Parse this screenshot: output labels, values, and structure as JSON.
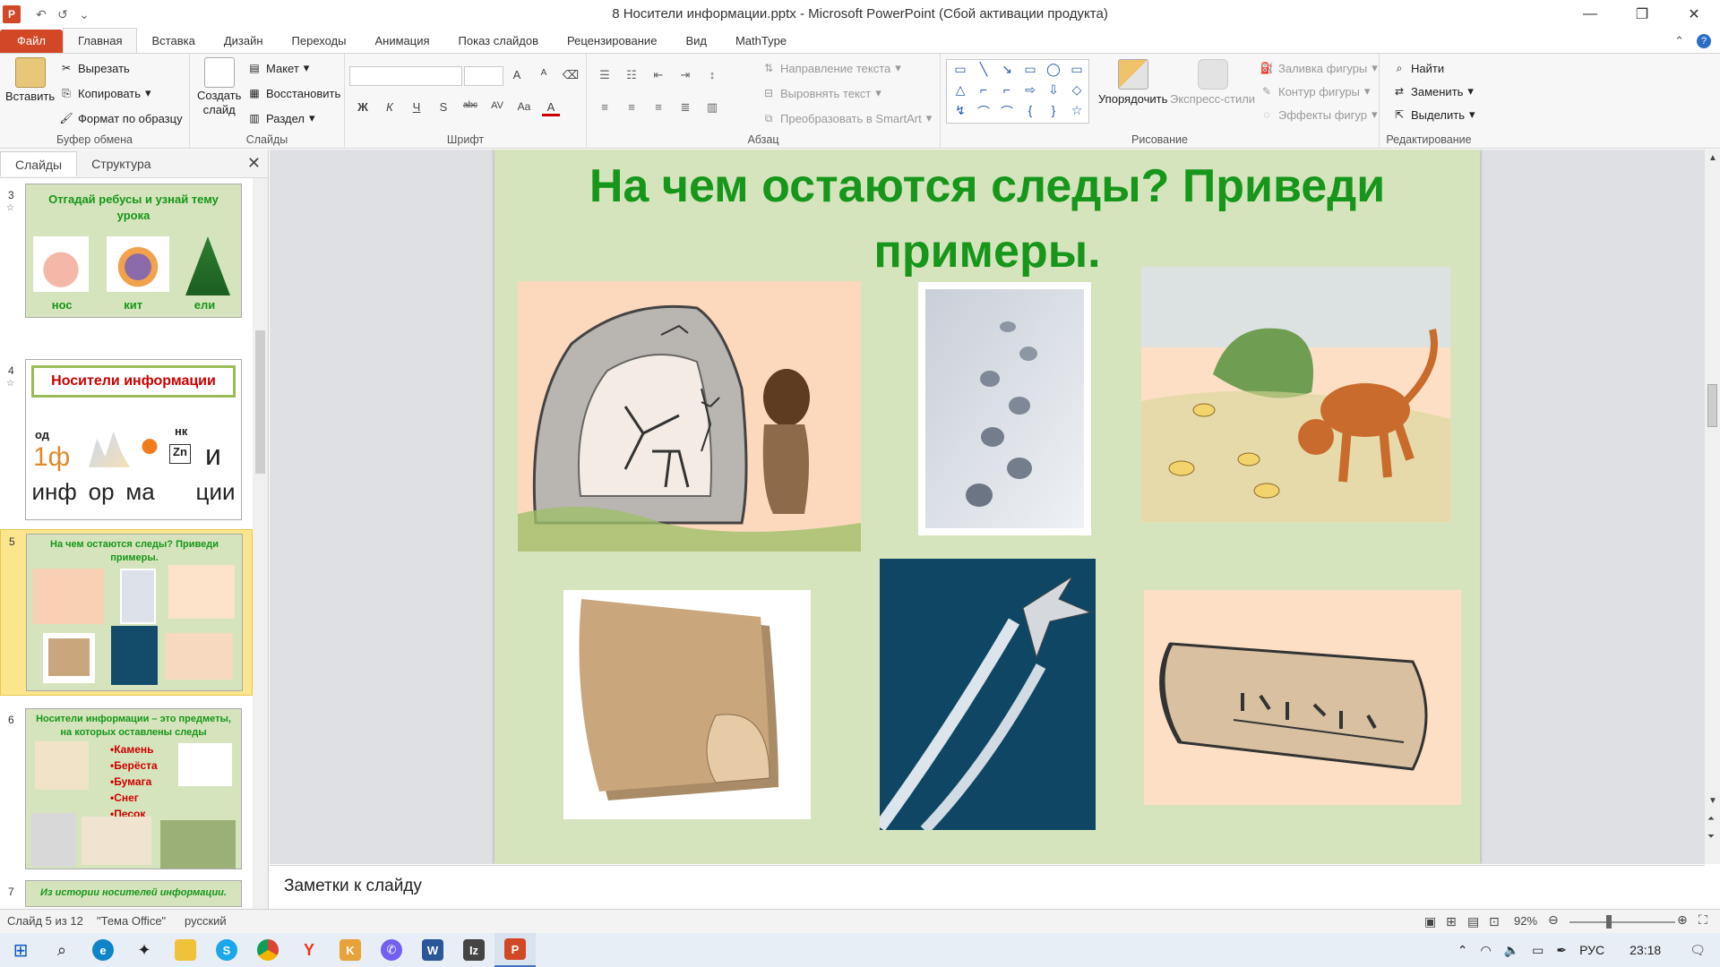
{
  "window": {
    "title": "8 Носители информации.pptx  -  Microsoft PowerPoint (Сбой активации продукта)",
    "app_logo": "P",
    "quick_access": [
      "↶",
      "↺",
      "⌄"
    ],
    "controls": [
      "—",
      "❐",
      "✕"
    ]
  },
  "ribbon": {
    "file_tab": "Файл",
    "tabs": [
      "Главная",
      "Вставка",
      "Дизайн",
      "Переходы",
      "Анимация",
      "Показ слайдов",
      "Рецензирование",
      "Вид",
      "MathType"
    ],
    "active_tab": "Главная",
    "clipboard": {
      "paste": "Вставить",
      "cut": "Вырезать",
      "copy": "Копировать",
      "format_painter": "Формат по образцу",
      "label": "Буфер обмена"
    },
    "slides": {
      "new_slide_line1": "Создать",
      "new_slide_line2": "слайд",
      "layout": "Макет",
      "reset": "Восстановить",
      "section": "Раздел",
      "label": "Слайды"
    },
    "font": {
      "bold": "Ж",
      "italic": "К",
      "underline": "Ч",
      "shadow": "S",
      "strike": "abc",
      "spacing": "AV",
      "case": "Aa",
      "color": "A",
      "grow": "A",
      "shrink": "A",
      "label": "Шрифт"
    },
    "paragraph": {
      "text_direction": "Направление текста",
      "align_text": "Выровнять текст",
      "smartart": "Преобразовать в SmartArt",
      "label": "Абзац"
    },
    "drawing": {
      "shapes": [
        "▭",
        "╲",
        "↘",
        "▭",
        "◯",
        "▭",
        "△",
        "⌐",
        "⌐",
        "⇨",
        "⇩",
        "◇",
        "↯",
        "⌒",
        "⌒",
        "{",
        "}",
        "☆"
      ],
      "arrange": "Упорядочить",
      "quick_styles": "Экспресс-стили",
      "fill": "Заливка фигуры",
      "outline": "Контур фигуры",
      "effects": "Эффекты фигур",
      "label": "Рисование"
    },
    "editing": {
      "find": "Найти",
      "replace": "Заменить",
      "select": "Выделить",
      "label": "Редактирование"
    }
  },
  "left_panel": {
    "tabs": [
      "Слайды",
      "Структура"
    ],
    "close": "✕",
    "thumbnails": [
      {
        "num": "3",
        "title": "Отгадай ребусы и узнай тему урока",
        "words": [
          "нос",
          "кит",
          "ели"
        ]
      },
      {
        "num": "4",
        "title": "Носители  информации",
        "top": [
          "од",
          "нк"
        ],
        "letters": [
          "1ф",
          "Zn",
          "и"
        ],
        "syllables": [
          "инф",
          "ор",
          "ма",
          "ции"
        ]
      },
      {
        "num": "5",
        "title": "На чем остаются следы? Приведи примеры."
      },
      {
        "num": "6",
        "title": "Носители  информации  – это предметы, на которых оставлены  следы",
        "items": [
          "•Камень",
          "•Берёста",
          "•Бумага",
          "•Снег",
          "•Песок"
        ]
      },
      {
        "num": "7",
        "title": "Из истории  носителей  информации."
      }
    ]
  },
  "slide": {
    "title": "На чем остаются следы? Приведи примеры."
  },
  "notes": {
    "placeholder": "Заметки к слайду"
  },
  "status": {
    "slide_info": "Слайд 5 из 12",
    "theme": "\"Тема Office\"",
    "language": "русский",
    "zoom": "92%"
  },
  "taskbar": {
    "language": "РУС",
    "time": "23:18"
  }
}
